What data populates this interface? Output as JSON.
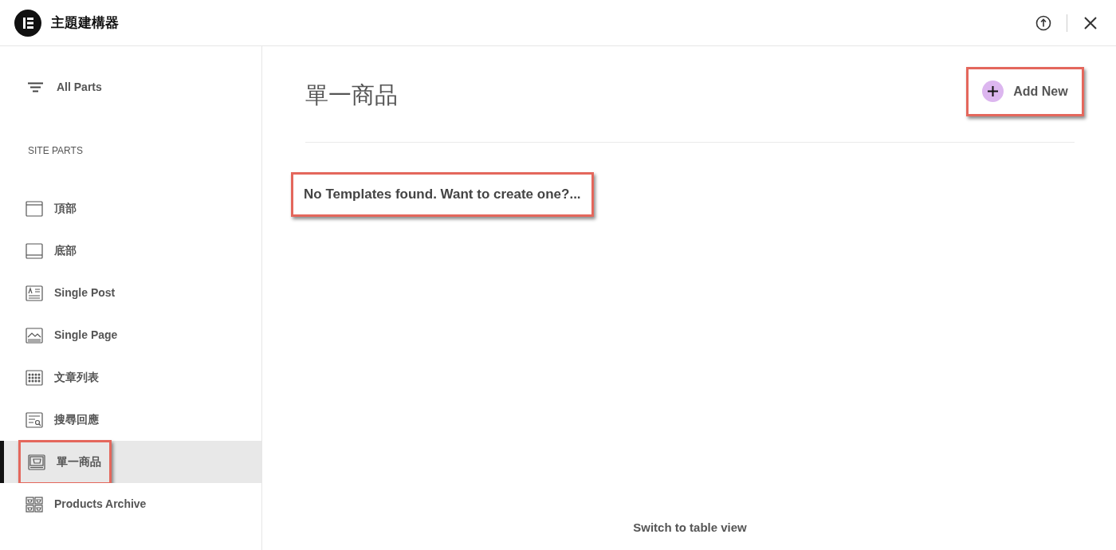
{
  "header": {
    "title": "主題建構器"
  },
  "sidebar": {
    "all_parts": "All Parts",
    "section_label": "SITE PARTS",
    "items": [
      {
        "kind": "header",
        "label": "頂部",
        "selected": false,
        "highlighted": false
      },
      {
        "kind": "footer",
        "label": "底部",
        "selected": false,
        "highlighted": false
      },
      {
        "kind": "post",
        "label": "Single Post",
        "selected": false,
        "highlighted": false
      },
      {
        "kind": "page",
        "label": "Single Page",
        "selected": false,
        "highlighted": false
      },
      {
        "kind": "archive",
        "label": "文章列表",
        "selected": false,
        "highlighted": false
      },
      {
        "kind": "search",
        "label": "搜尋回應",
        "selected": false,
        "highlighted": false
      },
      {
        "kind": "product",
        "label": "單一商品",
        "selected": true,
        "highlighted": true
      },
      {
        "kind": "products-archive",
        "label": "Products Archive",
        "selected": false,
        "highlighted": false
      }
    ]
  },
  "main": {
    "title": "單一商品",
    "add_button": {
      "label": "Add New",
      "highlighted": true
    },
    "empty_message": {
      "text": "No Templates found. Want to create one?...",
      "highlighted": true
    },
    "switch_link": "Switch to table view"
  }
}
